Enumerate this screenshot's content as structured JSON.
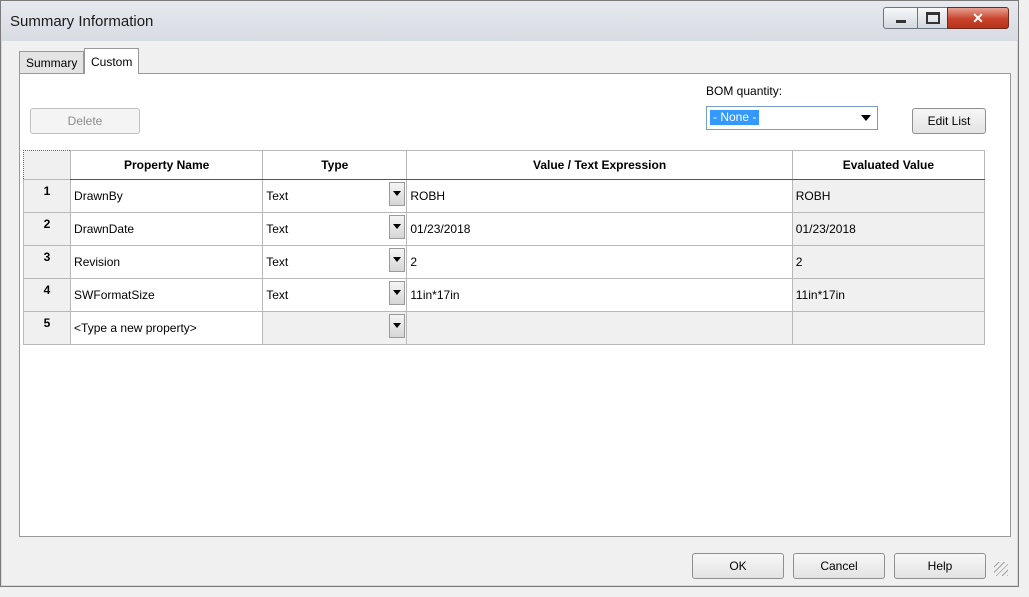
{
  "window": {
    "title": "Summary Information",
    "min_symbol": "",
    "close_symbol": "✕"
  },
  "tabs": [
    {
      "label": "Summary",
      "active": false
    },
    {
      "label": "Custom",
      "active": true
    }
  ],
  "toolbar": {
    "delete_label": "Delete",
    "bom_label": "BOM quantity:",
    "bom_value": "- None -",
    "edit_list_label": "Edit List"
  },
  "table": {
    "headers": [
      "Property Name",
      "Type",
      "Value / Text Expression",
      "Evaluated Value"
    ],
    "rows": [
      {
        "num": "1",
        "name": "DrawnBy",
        "type": "Text",
        "value": "ROBH",
        "evaluated": "ROBH"
      },
      {
        "num": "2",
        "name": "DrawnDate",
        "type": "Text",
        "value": "01/23/2018",
        "evaluated": "01/23/2018"
      },
      {
        "num": "3",
        "name": "Revision",
        "type": "Text",
        "value": "2",
        "evaluated": "2"
      },
      {
        "num": "4",
        "name": "SWFormatSize",
        "type": "Text",
        "value": "11in*17in",
        "evaluated": "11in*17in"
      },
      {
        "num": "5",
        "name": "<Type a new property>",
        "type": "",
        "value": "",
        "evaluated": ""
      }
    ]
  },
  "footer": {
    "ok_label": "OK",
    "cancel_label": "Cancel",
    "help_label": "Help"
  },
  "colors": {
    "selection": "#3399ff",
    "close_button": "#c8432a"
  }
}
